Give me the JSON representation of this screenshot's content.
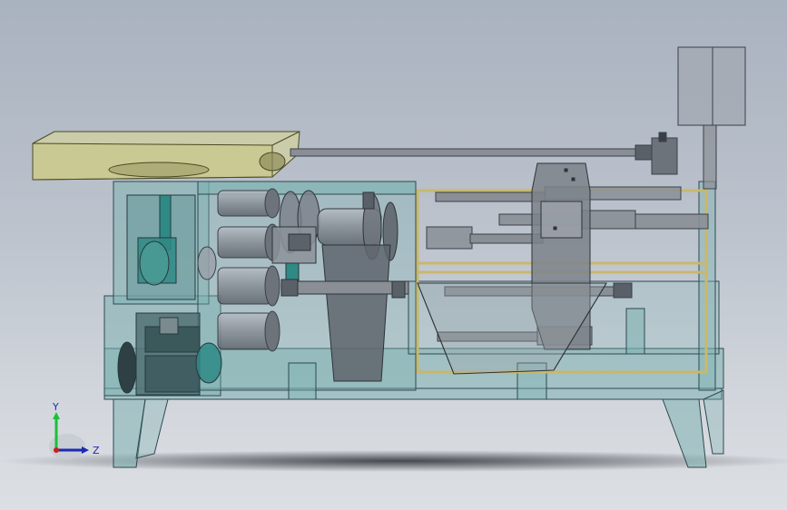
{
  "viewport": {
    "background_top": "#a9b2bf",
    "background_bottom": "#dcdfe3"
  },
  "colors": {
    "frame_fill": "#7fb3b3",
    "frame_stroke": "#2c4a50",
    "belt_guard_fill": "#d7d49a",
    "part_gray": "#8a8f96",
    "part_dark": "#5a6068",
    "yellow_frame": "#c9b86b"
  },
  "triad": {
    "y_label": "Y",
    "z_label": "Z",
    "y_color": "#1bbf3a",
    "z_color": "#1a2bb0",
    "x_color": "#c82020"
  }
}
